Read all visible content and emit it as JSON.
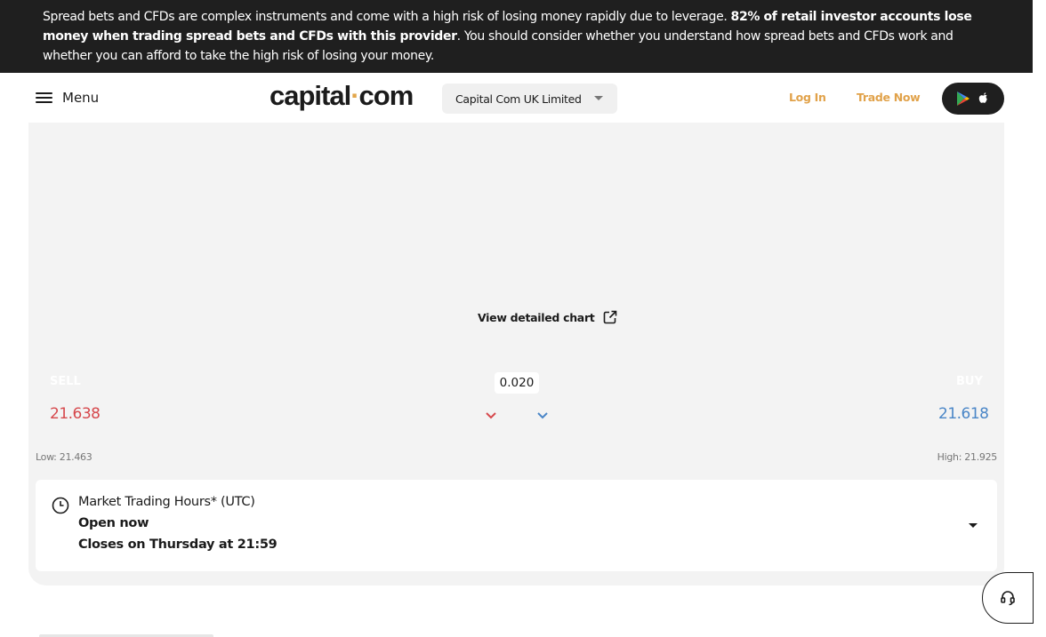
{
  "risk_banner": {
    "text_start": "Spread bets and CFDs are complex instruments and come with a high risk of losing money rapidly due to leverage. ",
    "text_bold": "82% of retail investor accounts lose money when trading spread bets and CFDs with this provider",
    "text_end": ". You should consider whether you understand how spread bets and CFDs work and whether you can afford to take the high risk of losing your money."
  },
  "header": {
    "menu_label": "Menu",
    "logo_left": "capital",
    "logo_dot": "·",
    "logo_right": "com",
    "entity_select": "Capital Com UK Limited",
    "login_label": "Log In",
    "trade_label": "Trade Now"
  },
  "chart_link": {
    "label": "View detailed chart"
  },
  "quote": {
    "sell_label": "SELL",
    "buy_label": "BUY",
    "spread": "0.020",
    "sell_price": "21.638",
    "buy_price": "21.618",
    "low": "Low: 21.463",
    "high": "High: 21.925"
  },
  "hours": {
    "title": "Market Trading Hours* (UTC)",
    "status": "Open now",
    "closes": "Closes on Thursday at 21:59"
  },
  "colors": {
    "accent": "#e1a24a",
    "sell": "#d6484c",
    "buy": "#4a86c7",
    "banner_bg": "#1f1f1f",
    "card_bg": "#f3f3f3"
  },
  "icons": [
    "hamburger-icon",
    "google-play-icon",
    "apple-icon",
    "external-link-icon",
    "chevron-down-icon",
    "clock-icon",
    "caret-down-icon",
    "headset-icon"
  ]
}
